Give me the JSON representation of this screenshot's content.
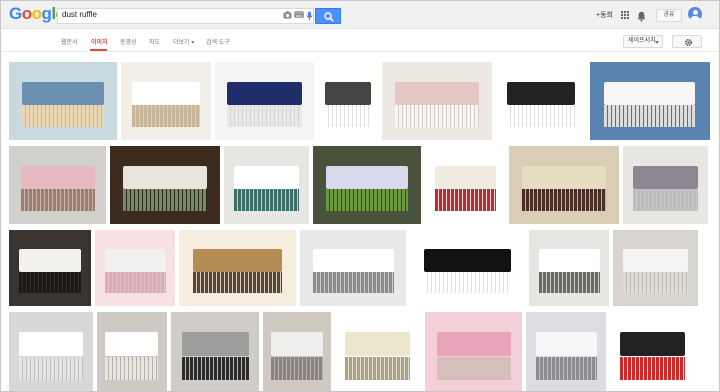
{
  "header": {
    "logo": [
      "G",
      "o",
      "o",
      "g",
      "l",
      "e"
    ],
    "logo_colors": [
      "#4285f4",
      "#ea4335",
      "#fbbc05",
      "#4285f4",
      "#34a853",
      "#ea4335"
    ],
    "search_value": "dust ruffle",
    "plus_label": "+동희",
    "share_label": "공유",
    "icons": [
      "camera-icon",
      "keyboard-icon",
      "microphone-icon",
      "search-icon",
      "apps-icon",
      "bell-icon",
      "avatar"
    ]
  },
  "tabs": {
    "items": [
      "웹문서",
      "이미지",
      "동영상",
      "지도",
      "더보기 ▾",
      "검색 도구"
    ],
    "active_index": 1,
    "safesearch_label": "세이프서치",
    "accent": "#dd4b39"
  },
  "images": [
    {
      "name": "floral-bed",
      "colors": [
        "#c9d9e0",
        "#6a8fb0",
        "#e8d7b2"
      ]
    },
    {
      "name": "white-skirt-hand",
      "colors": [
        "#f2efe9",
        "#ffffff",
        "#c8b59a"
      ]
    },
    {
      "name": "navy-skirt",
      "colors": [
        "#f4f4f4",
        "#1f2d6a",
        "#e8e8e8"
      ]
    },
    {
      "name": "patent-diagram",
      "colors": [
        "#ffffff",
        "#444444",
        "#ffffff"
      ]
    },
    {
      "name": "pink-throw-bed",
      "colors": [
        "#ece8e2",
        "#e4c6c4",
        "#f8f6f2"
      ]
    },
    {
      "name": "lace-sketch",
      "colors": [
        "#ffffff",
        "#222222",
        "#ffffff"
      ]
    },
    {
      "name": "eyelet-skirt",
      "colors": [
        "#5a84b0",
        "#f6f6f6",
        "#dddddd"
      ]
    },
    {
      "name": "quilt-pink-skirt",
      "colors": [
        "#d2d0cc",
        "#e9b9c1",
        "#a87b68"
      ]
    },
    {
      "name": "green-skirt-room",
      "colors": [
        "#3d2b1e",
        "#e8e5dd",
        "#6f8f6a"
      ]
    },
    {
      "name": "teal-skirt",
      "colors": [
        "#e6e6e2",
        "#ffffff",
        "#3c6e68"
      ]
    },
    {
      "name": "green-sheet-bed",
      "colors": [
        "#48523a",
        "#dad8ec",
        "#6a9640"
      ]
    },
    {
      "name": "white-ruffle-frame",
      "colors": [
        "#ffffff",
        "#f0ebe0",
        "#bc2c2a"
      ]
    },
    {
      "name": "round-bed",
      "colors": [
        "#d9cdb6",
        "#e6dcc0",
        "#4a2e28"
      ]
    },
    {
      "name": "grey-bedding",
      "colors": [
        "#e9e7e4",
        "#8c8790",
        "#bdbdc0"
      ]
    },
    {
      "name": "white-bed-dark",
      "colors": [
        "#3a3430",
        "#f3f1ee",
        "#1c1a18"
      ]
    },
    {
      "name": "pink-crib",
      "colors": [
        "#f7e1e4",
        "#f2f0ee",
        "#e7a9b4"
      ]
    },
    {
      "name": "tan-skirt",
      "colors": [
        "#f4ede0",
        "#b48a55",
        "#5a4630"
      ]
    },
    {
      "name": "white-linen-bed",
      "colors": [
        "#e9e9e9",
        "#ffffff",
        "#8e8c8a"
      ]
    },
    {
      "name": "bed-line-drawing",
      "colors": [
        "#ffffff",
        "#111111",
        "#ffffff"
      ]
    },
    {
      "name": "iron-bed",
      "colors": [
        "#e8e6e2",
        "#ffffff",
        "#6b6a68"
      ]
    },
    {
      "name": "headboard-bed",
      "colors": [
        "#d8d5d0",
        "#f6f4f2",
        "#e2dcd0"
      ]
    },
    {
      "name": "white-box-skirt",
      "colors": [
        "#d8d8d8",
        "#ffffff",
        "#e6e6e6"
      ]
    },
    {
      "name": "pleated-skirt",
      "colors": [
        "#cfcac4",
        "#ffffff",
        "#e8e4de"
      ]
    },
    {
      "name": "gingham-panel",
      "colors": [
        "#d0ccc8",
        "#9e9e9c",
        "#2d2d2d"
      ]
    },
    {
      "name": "ruffled-quilt",
      "colors": [
        "#cfc9c2",
        "#f0eeec",
        "#8a8480"
      ]
    },
    {
      "name": "tiered-ruffle",
      "colors": [
        "#ffffff",
        "#ece6cf",
        "#b0a276"
      ]
    },
    {
      "name": "pink-roses-bed",
      "colors": [
        "#f3d0d8",
        "#e8a4b8",
        "#d4c2b6"
      ]
    },
    {
      "name": "canopy-room",
      "colors": [
        "#dcdde2",
        "#f7f7f7",
        "#8a8c92"
      ]
    },
    {
      "name": "ruffle-sketch-red",
      "colors": [
        "#ffffff",
        "#222222",
        "#cc2a2a"
      ]
    }
  ]
}
